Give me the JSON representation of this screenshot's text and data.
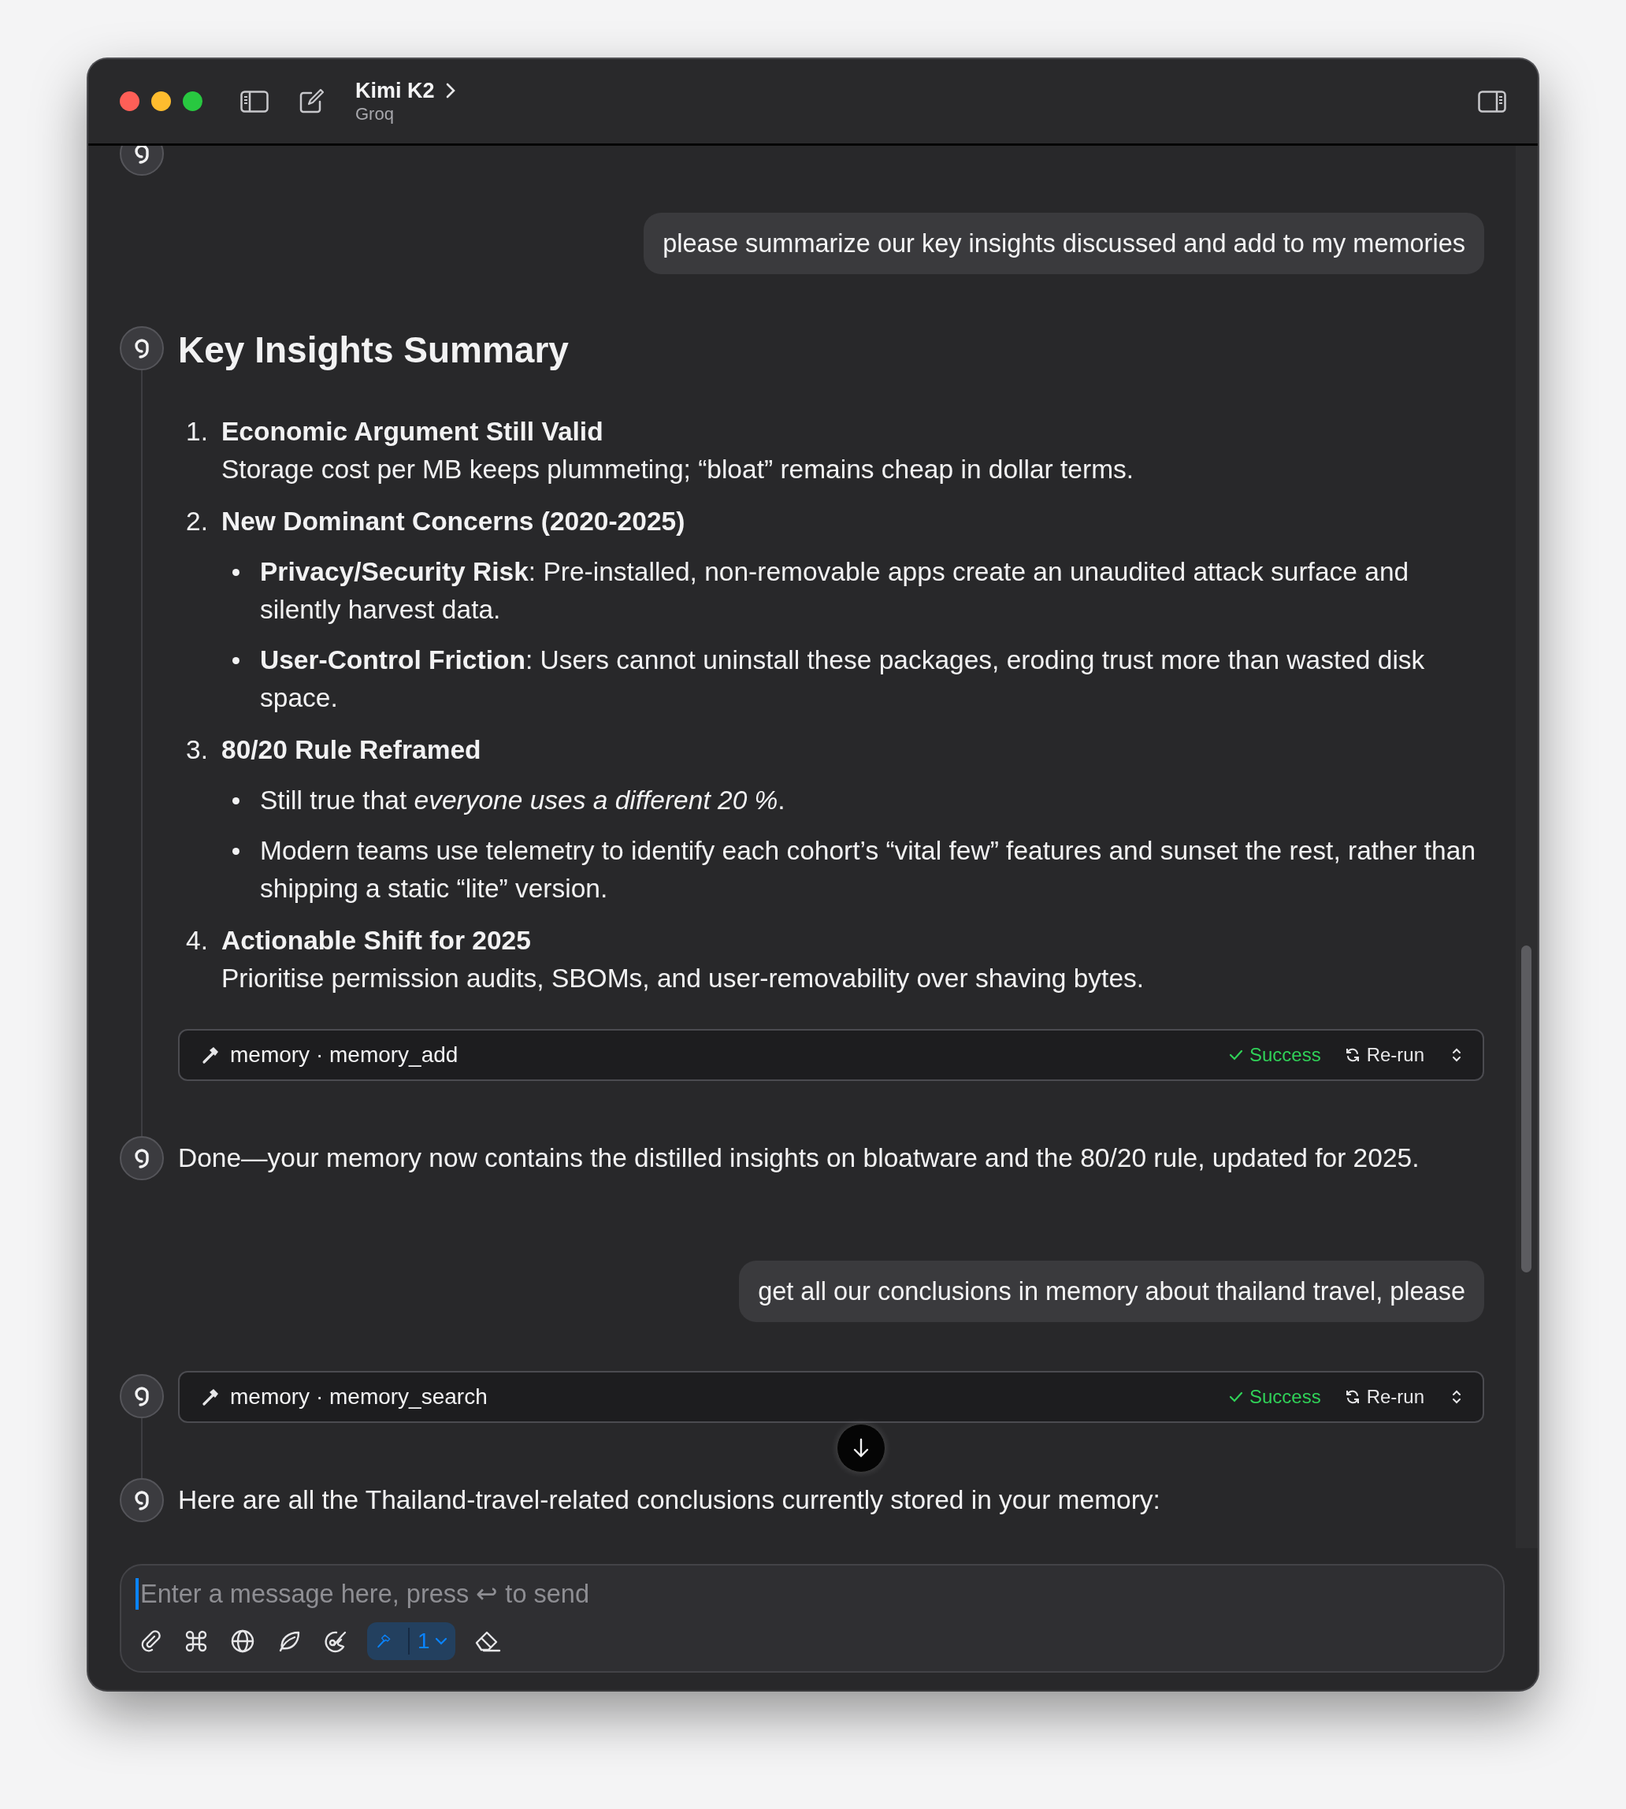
{
  "window": {
    "title": "Kimi K2",
    "subtitle": "Groq"
  },
  "messages": [
    {
      "kind": "assistant_partial"
    },
    {
      "kind": "user",
      "text": "please summarize our key insights discussed and add to my memories"
    },
    {
      "kind": "assistant",
      "blocks": [
        {
          "kind": "heading",
          "text": "Key Insights Summary"
        },
        {
          "kind": "ordered_list",
          "items": [
            {
              "number": "1.",
              "title": "Economic Argument Still Valid",
              "text": "Storage cost per MB keeps plummeting; “bloat” remains cheap in dollar terms."
            },
            {
              "number": "2.",
              "title": "New Dominant Concerns (2020-2025)",
              "bullets": [
                "**Privacy/Security Risk**: Pre-installed, non-removable apps create an unaudited attack surface and silently harvest data.",
                "**User-Control Friction**: Users cannot uninstall these packages, eroding trust more than wasted disk space."
              ]
            },
            {
              "number": "3.",
              "title": "80/20 Rule Reframed",
              "bullets": [
                "Still true that *everyone uses a different 20 %*.",
                "Modern teams use telemetry to identify each cohort’s “vital few” features and sunset the rest, rather than shipping a static “lite” version."
              ]
            },
            {
              "number": "4.",
              "title": "Actionable Shift for 2025",
              "text": "Prioritise permission audits, SBOMs, and user-removability over shaving bytes."
            }
          ]
        },
        {
          "kind": "tool",
          "name": "memory · memory_add",
          "status": "Success",
          "action": "Re-run"
        }
      ]
    },
    {
      "kind": "assistant",
      "blocks": [
        {
          "kind": "paragraph",
          "text": "Done—your memory now contains the distilled insights on bloatware and the 80/20 rule, updated for 2025."
        }
      ]
    },
    {
      "kind": "user",
      "text": "get all our conclusions in memory about thailand travel, please"
    },
    {
      "kind": "assistant",
      "blocks": [
        {
          "kind": "tool",
          "name": "memory · memory_search",
          "status": "Success",
          "action": "Re-run"
        }
      ]
    },
    {
      "kind": "assistant",
      "blocks": [
        {
          "kind": "paragraph",
          "text": "Here are all the Thailand-travel-related conclusions currently stored in your memory:"
        }
      ]
    }
  ],
  "composer": {
    "placeholder": "Enter a message here, press ↩ to send",
    "tools": {
      "count": "1",
      "active": true
    }
  }
}
